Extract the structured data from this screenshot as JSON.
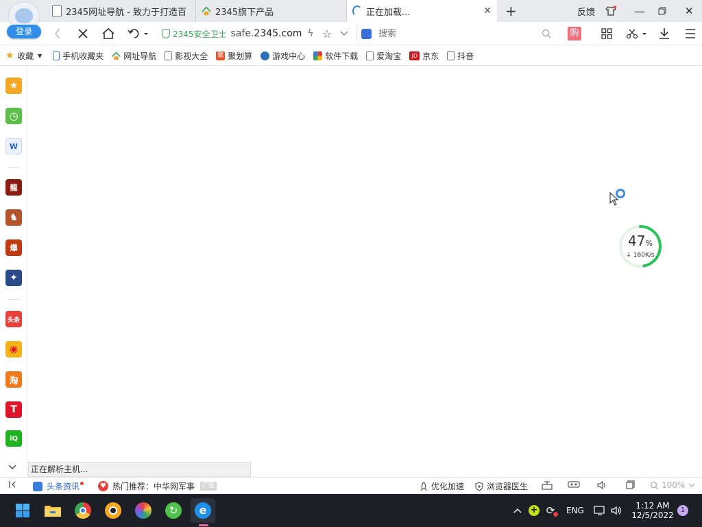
{
  "user": {
    "login_label": "登录"
  },
  "tabs": [
    {
      "title": "2345网址导航 - 致力于打造百",
      "icon": "document-icon",
      "active": false
    },
    {
      "title": "2345旗下产品",
      "icon": "2345-home-icon",
      "active": false
    },
    {
      "title": "正在加载...",
      "icon": "loading-spinner-icon",
      "active": true
    }
  ],
  "window": {
    "feedback_label": "反馈"
  },
  "address": {
    "safe_label": "2345安全卫士",
    "url_prefix": "safe.",
    "url_domain": "2345.com"
  },
  "search": {
    "placeholder": "搜索"
  },
  "toolbar": {
    "shop_label": "购"
  },
  "bookmarks": [
    {
      "label": "收藏",
      "icon": "star-icon",
      "color": "#f5a623"
    },
    {
      "label": "手机收藏夹",
      "icon": "phone-icon",
      "color": "#3b7ddd"
    },
    {
      "label": "网址导航",
      "icon": "2345-home-icon",
      "color": "#3aa757"
    },
    {
      "label": "影视大全",
      "icon": "document-icon",
      "color": "#ffffff"
    },
    {
      "label": "聚划算",
      "icon": "juhuasuan-icon",
      "color": "#e8542a"
    },
    {
      "label": "游戏中心",
      "icon": "game-icon",
      "color": "#2d6fb7"
    },
    {
      "label": "软件下载",
      "icon": "software-icon",
      "color": "#e0402d"
    },
    {
      "label": "爱淘宝",
      "icon": "document-icon",
      "color": "#ffffff"
    },
    {
      "label": "京东",
      "icon": "jd-icon",
      "color": "#c9151e"
    },
    {
      "label": "抖音",
      "icon": "document-icon",
      "color": "#ffffff"
    }
  ],
  "sidebar": {
    "items": [
      {
        "name": "favorites",
        "icon": "star-icon",
        "color": "#f5a623",
        "glyph": "★"
      },
      {
        "name": "history",
        "icon": "clock-icon",
        "color": "#5cbf4a",
        "glyph": "◷"
      },
      {
        "name": "word-doc",
        "icon": "word-icon",
        "color": "#2b64c4",
        "glyph": "W"
      },
      {
        "name": "game-1",
        "icon": "game-icon",
        "color": "#8a1c12",
        "glyph": "龍"
      },
      {
        "name": "game-2",
        "icon": "game-icon",
        "color": "#b3542a",
        "glyph": "♞"
      },
      {
        "name": "game-3",
        "icon": "game-icon",
        "color": "#c23a14",
        "glyph": "爆"
      },
      {
        "name": "game-4",
        "icon": "game-icon",
        "color": "#2a4a8a",
        "glyph": "✦"
      },
      {
        "name": "toutiao",
        "icon": "toutiao-icon",
        "color": "#e8403a",
        "glyph": "头条"
      },
      {
        "name": "weibo",
        "icon": "weibo-icon",
        "color": "#f5b31a",
        "glyph": "◉"
      },
      {
        "name": "taobao",
        "icon": "taobao-icon",
        "color": "#f07a1a",
        "glyph": "淘"
      },
      {
        "name": "tmall",
        "icon": "tmall-icon",
        "color": "#e0152b",
        "glyph": "T"
      },
      {
        "name": "iqiyi",
        "icon": "iqiyi-icon",
        "color": "#1fb31f",
        "glyph": "iQ"
      }
    ]
  },
  "page": {
    "status_text": "正在解析主机..."
  },
  "download": {
    "progress_percent": 47,
    "percent_sign": "%",
    "speed": "↓ 160K/s"
  },
  "statusbar": {
    "news_label": "头条资讯",
    "hot_prefix": "热门推荐：中华网军事",
    "ad_label": "广告",
    "optimize_label": "优化加速",
    "doctor_label": "浏览器医生",
    "zoom_label": "100%"
  },
  "taskbar": {
    "apps": [
      "windows-start-icon",
      "file-explorer-icon",
      "chrome-icon",
      "browser-icon",
      "colorful-browser-icon",
      "refresh-app-icon",
      "ie-browser-icon"
    ],
    "lang": "ENG",
    "time": "1:12 AM",
    "date": "12/5/2022",
    "notification_count": "1"
  }
}
